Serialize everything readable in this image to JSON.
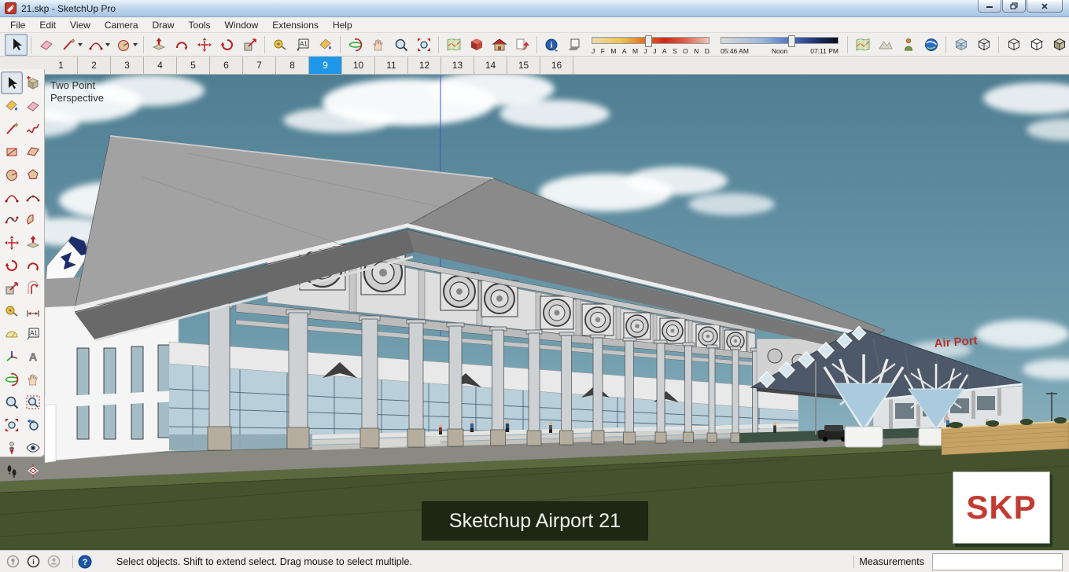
{
  "window": {
    "title": "21.skp - SketchUp Pro",
    "minimize": "minimize",
    "restore": "restore",
    "close": "close"
  },
  "menu_bar": {
    "items": [
      "File",
      "Edit",
      "View",
      "Camera",
      "Draw",
      "Tools",
      "Window",
      "Extensions",
      "Help"
    ]
  },
  "toolbar": {
    "principal": [
      "select",
      "eraser",
      "line",
      "arc",
      "shapes"
    ],
    "edit": [
      "push-pull",
      "follow-me",
      "move",
      "rotate",
      "scale"
    ],
    "construction": [
      "tape-measure",
      "text",
      "paint-bucket"
    ],
    "camera": [
      "orbit",
      "pan",
      "zoom",
      "zoom-extents"
    ],
    "warehouse": [
      "add-location",
      "extension-warehouse",
      "3d-warehouse",
      "share-model"
    ],
    "shadows": {
      "info": "shadow-info",
      "toggle": "shadow-toggle",
      "months": [
        "J",
        "F",
        "M",
        "A",
        "M",
        "J",
        "J",
        "A",
        "S",
        "O",
        "N",
        "D"
      ],
      "time_start": "05:46 AM",
      "time_mid": "Noon",
      "time_end": "07:11 PM",
      "month_slider_pos": "45%",
      "time_slider_pos": "57%"
    },
    "location": [
      "add-location",
      "toggle-terrain",
      "photo-textures",
      "google-earth"
    ],
    "face_style": [
      "x-ray",
      "back-edges",
      "wireframe",
      "hidden-line",
      "shaded",
      "shaded-with-textures",
      "monochrome"
    ],
    "active_face_style": "shaded-with-textures",
    "active_tool": "select"
  },
  "scene_tabs": {
    "tabs": [
      "1",
      "2",
      "3",
      "4",
      "5",
      "6",
      "7",
      "8",
      "9",
      "10",
      "11",
      "12",
      "13",
      "14",
      "15",
      "16"
    ],
    "active": "9"
  },
  "left_toolbar": {
    "tools": [
      "select",
      "make-component",
      "paint-bucket",
      "eraser",
      "line",
      "freehand",
      "rectangle",
      "rotated-rectangle",
      "circle",
      "polygon",
      "arc",
      "two-point-arc",
      "three-point-arc",
      "pie",
      "move",
      "push-pull",
      "rotate",
      "follow-me",
      "scale",
      "offset",
      "tape-measure",
      "dimension",
      "protractor",
      "text",
      "axes",
      "3d-text",
      "orbit",
      "pan",
      "zoom",
      "zoom-window",
      "zoom-extents",
      "previous",
      "position-camera",
      "look-around",
      "walk",
      "section-plane"
    ],
    "active_tool": "select"
  },
  "viewport": {
    "persp_line1": "Two Point",
    "persp_line2": "Perspective",
    "caption": "Sketchup Airport 21",
    "logo_text": "SKP",
    "sign_text": "Air Port",
    "colors": {
      "sky_top": "#4f7e92",
      "sky_bottom": "#a9c6cf",
      "grass": "#44532d",
      "roof_gray": "#8a8a8a",
      "pavilion_roof": "#4d5868",
      "wall_tan": "#c7a266",
      "logo_red": "#c23a32",
      "axis_blue": "#4553cc"
    }
  },
  "status_bar": {
    "message": "Select objects. Shift to extend select. Drag mouse to select multiple.",
    "measurements_label": "Measurements",
    "measurements_value": ""
  }
}
